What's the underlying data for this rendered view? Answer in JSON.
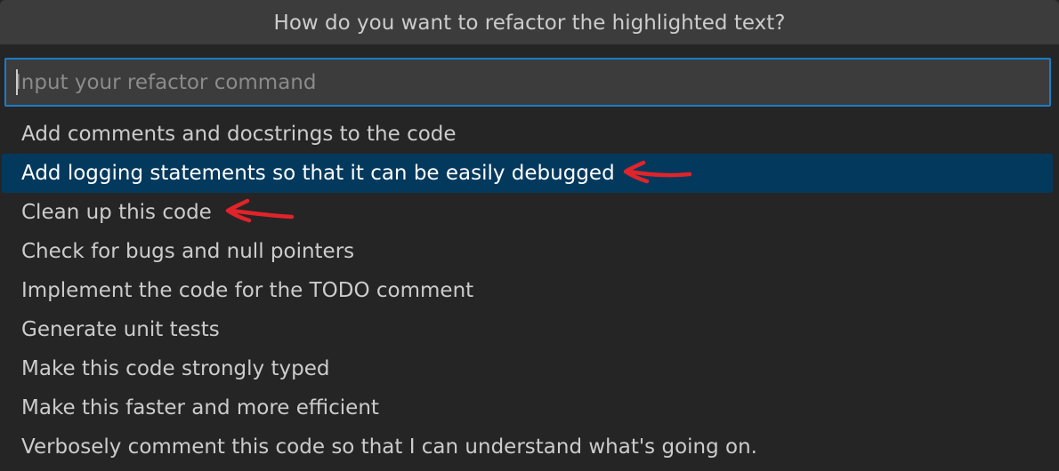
{
  "title": "How do you want to refactor the highlighted text?",
  "input": {
    "value": "",
    "placeholder": "Input your refactor command"
  },
  "items": [
    {
      "label": "Add comments and docstrings to the code"
    },
    {
      "label": "Add logging statements so that it can be easily debugged",
      "selected": true
    },
    {
      "label": "Clean up this code"
    },
    {
      "label": "Check for bugs and null pointers"
    },
    {
      "label": "Implement the code for the TODO comment"
    },
    {
      "label": "Generate unit tests"
    },
    {
      "label": "Make this code strongly typed"
    },
    {
      "label": "Make this faster and more efficient"
    },
    {
      "label": "Verbosely comment this code so that I can understand what's going on."
    }
  ],
  "annotations": {
    "arrow_icon": "red-arrow-left-icon",
    "arrow_color": "#e0242a"
  },
  "colors": {
    "background": "#252526",
    "title_bar": "#3c3c3c",
    "input_border": "#1a7cc7",
    "selected_bg": "#04395e"
  }
}
